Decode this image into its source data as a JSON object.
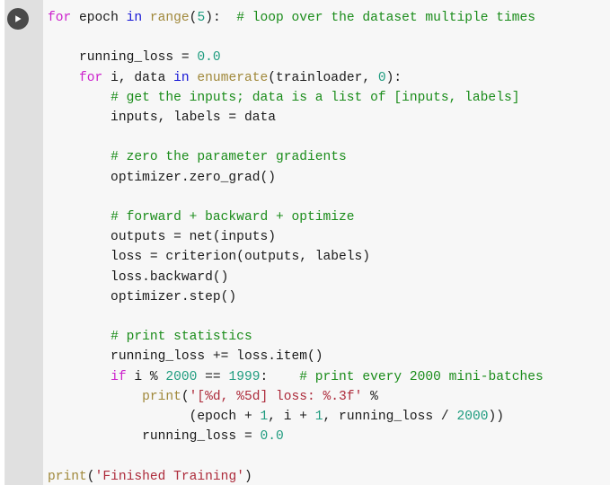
{
  "cell": {
    "run_button": {
      "icon": "play-icon",
      "label": "Run cell",
      "circle_color": "#4a4a4a",
      "glyph_color": "#ffffff"
    },
    "gutter_color": "#e0e0e0",
    "background_color": "#f7f7f7",
    "language": "python"
  },
  "theme": {
    "keyword": "#cc22cc",
    "operator_keyword": "#1414d6",
    "function": "#a0883a",
    "number": "#1f9c7f",
    "string": "#ad2b3b",
    "comment": "#1a8c1a",
    "text": "#1a1a1a"
  },
  "code": {
    "full_text": "for epoch in range(5):  # loop over the dataset multiple times\n\n    running_loss = 0.0\n    for i, data in enumerate(trainloader, 0):\n        # get the inputs; data is a list of [inputs, labels]\n        inputs, labels = data\n\n        # zero the parameter gradients\n        optimizer.zero_grad()\n\n        # forward + backward + optimize\n        outputs = net(inputs)\n        loss = criterion(outputs, labels)\n        loss.backward()\n        optimizer.step()\n\n        # print statistics\n        running_loss += loss.item()\n        if i % 2000 == 1999:    # print every 2000 mini-batches\n            print('[%d, %5d] loss: %.3f' %\n                  (epoch + 1, i + 1, running_loss / 2000))\n            running_loss = 0.0\n\nprint('Finished Training')",
    "lines": [
      {
        "n": 1,
        "tokens": [
          {
            "t": "for",
            "c": "kw"
          },
          {
            "t": " epoch ",
            "c": "txt"
          },
          {
            "t": "in",
            "c": "op-kw"
          },
          {
            "t": " ",
            "c": "txt"
          },
          {
            "t": "range",
            "c": "fn"
          },
          {
            "t": "(",
            "c": "txt"
          },
          {
            "t": "5",
            "c": "num"
          },
          {
            "t": "):  ",
            "c": "txt"
          },
          {
            "t": "# loop over the dataset multiple times",
            "c": "com"
          }
        ]
      },
      {
        "n": 2,
        "tokens": []
      },
      {
        "n": 3,
        "tokens": [
          {
            "t": "    running_loss = ",
            "c": "txt"
          },
          {
            "t": "0.0",
            "c": "num"
          }
        ]
      },
      {
        "n": 4,
        "tokens": [
          {
            "t": "    ",
            "c": "txt"
          },
          {
            "t": "for",
            "c": "kw"
          },
          {
            "t": " i, data ",
            "c": "txt"
          },
          {
            "t": "in",
            "c": "op-kw"
          },
          {
            "t": " ",
            "c": "txt"
          },
          {
            "t": "enumerate",
            "c": "fn"
          },
          {
            "t": "(trainloader, ",
            "c": "txt"
          },
          {
            "t": "0",
            "c": "num"
          },
          {
            "t": "):",
            "c": "txt"
          }
        ]
      },
      {
        "n": 5,
        "tokens": [
          {
            "t": "        ",
            "c": "txt"
          },
          {
            "t": "# get the inputs; data is a list of [inputs, labels]",
            "c": "com"
          }
        ]
      },
      {
        "n": 6,
        "tokens": [
          {
            "t": "        inputs, labels = data",
            "c": "txt"
          }
        ]
      },
      {
        "n": 7,
        "tokens": []
      },
      {
        "n": 8,
        "tokens": [
          {
            "t": "        ",
            "c": "txt"
          },
          {
            "t": "# zero the parameter gradients",
            "c": "com"
          }
        ]
      },
      {
        "n": 9,
        "tokens": [
          {
            "t": "        optimizer.zero_grad()",
            "c": "txt"
          }
        ]
      },
      {
        "n": 10,
        "tokens": []
      },
      {
        "n": 11,
        "tokens": [
          {
            "t": "        ",
            "c": "txt"
          },
          {
            "t": "# forward + backward + optimize",
            "c": "com"
          }
        ]
      },
      {
        "n": 12,
        "tokens": [
          {
            "t": "        outputs = net(inputs)",
            "c": "txt"
          }
        ]
      },
      {
        "n": 13,
        "tokens": [
          {
            "t": "        loss = criterion(outputs, labels)",
            "c": "txt"
          }
        ]
      },
      {
        "n": 14,
        "tokens": [
          {
            "t": "        loss.backward()",
            "c": "txt"
          }
        ]
      },
      {
        "n": 15,
        "tokens": [
          {
            "t": "        optimizer.step()",
            "c": "txt"
          }
        ]
      },
      {
        "n": 16,
        "tokens": []
      },
      {
        "n": 17,
        "tokens": [
          {
            "t": "        ",
            "c": "txt"
          },
          {
            "t": "# print statistics",
            "c": "com"
          }
        ]
      },
      {
        "n": 18,
        "tokens": [
          {
            "t": "        running_loss += loss.item()",
            "c": "txt"
          }
        ]
      },
      {
        "n": 19,
        "tokens": [
          {
            "t": "        ",
            "c": "txt"
          },
          {
            "t": "if",
            "c": "kw"
          },
          {
            "t": " i % ",
            "c": "txt"
          },
          {
            "t": "2000",
            "c": "num"
          },
          {
            "t": " == ",
            "c": "txt"
          },
          {
            "t": "1999",
            "c": "num"
          },
          {
            "t": ":    ",
            "c": "txt"
          },
          {
            "t": "# print every 2000 mini-batches",
            "c": "com"
          }
        ]
      },
      {
        "n": 20,
        "tokens": [
          {
            "t": "            ",
            "c": "txt"
          },
          {
            "t": "print",
            "c": "fn"
          },
          {
            "t": "(",
            "c": "txt"
          },
          {
            "t": "'[%d, %5d] loss: %.3f'",
            "c": "str"
          },
          {
            "t": " %",
            "c": "txt"
          }
        ]
      },
      {
        "n": 21,
        "tokens": [
          {
            "t": "                  (epoch + ",
            "c": "txt"
          },
          {
            "t": "1",
            "c": "num"
          },
          {
            "t": ", i + ",
            "c": "txt"
          },
          {
            "t": "1",
            "c": "num"
          },
          {
            "t": ", running_loss / ",
            "c": "txt"
          },
          {
            "t": "2000",
            "c": "num"
          },
          {
            "t": "))",
            "c": "txt"
          }
        ]
      },
      {
        "n": 22,
        "tokens": [
          {
            "t": "            running_loss = ",
            "c": "txt"
          },
          {
            "t": "0.0",
            "c": "num"
          }
        ]
      },
      {
        "n": 23,
        "tokens": []
      },
      {
        "n": 24,
        "tokens": [
          {
            "t": "print",
            "c": "fn"
          },
          {
            "t": "(",
            "c": "txt"
          },
          {
            "t": "'Finished Training'",
            "c": "str"
          },
          {
            "t": ")",
            "c": "txt"
          }
        ]
      }
    ]
  }
}
